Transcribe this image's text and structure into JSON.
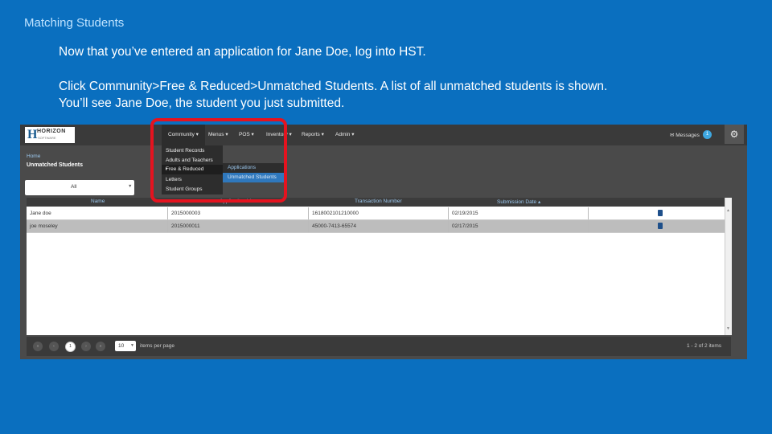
{
  "slide": {
    "title": "Matching Students",
    "para1": "Now that you’ve entered an application for Jane Doe, log into HST.",
    "para2_line1": "Click Community>Free & Reduced>Unmatched Students. A list of all unmatched students is shown.",
    "para2_line2": "You’ll see Jane Doe, the student you just submitted."
  },
  "app": {
    "logo_text": "HORIZON",
    "logo_sub": "SOFTWARE",
    "nav": [
      {
        "label": "Community ▾"
      },
      {
        "label": "Menus ▾"
      },
      {
        "label": "POS ▾"
      },
      {
        "label": "Inventory ▾"
      },
      {
        "label": "Reports ▾"
      },
      {
        "label": "Admin ▾"
      }
    ],
    "messages_label": "✉ Messages",
    "messages_count": "1",
    "breadcrumb": "Home",
    "page_title": "Unmatched Students",
    "filter_value": "All",
    "columns": [
      "Name",
      "Application Id",
      "Transaction Number",
      "Submission Date ▴"
    ],
    "rows": [
      {
        "name": "Jane doe",
        "app_id": "2015000003",
        "txn": "1618002101210000",
        "date": "02/19/2015"
      },
      {
        "name": "joe moseley",
        "app_id": "2015000011",
        "txn": "45000-7413-65574",
        "date": "02/17/2015"
      }
    ],
    "menu_items": [
      "Student Records",
      "Adults and Teachers",
      "Free & Reduced",
      "Letters",
      "Student Groups"
    ],
    "submenu_items": [
      "Applications",
      "Unmatched Students"
    ],
    "pager": {
      "first": "«",
      "prev": "‹",
      "current": "1",
      "next": "›",
      "last": "»",
      "per_page": "10",
      "per_page_label": "items per page",
      "count_text": "1 - 2 of 2 items"
    }
  },
  "colors": {
    "slide_bg": "#0a6fbf",
    "highlight": "#e5131f",
    "accent": "#2f78bd"
  }
}
